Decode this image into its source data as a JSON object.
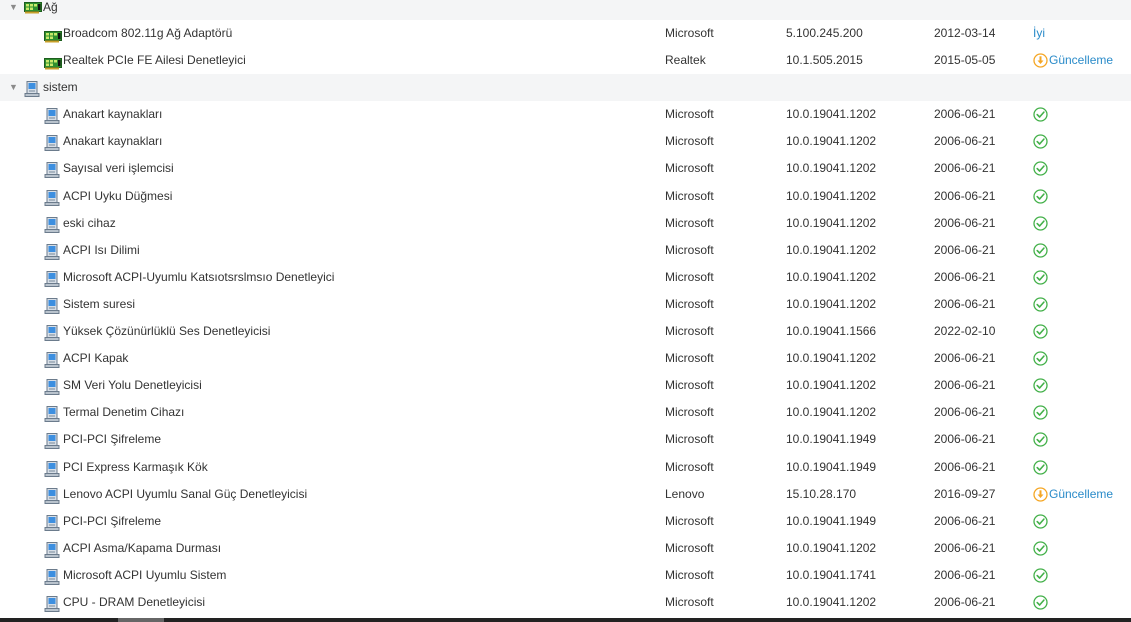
{
  "groups": [
    {
      "name": "Ağ",
      "icon": "network-card-icon",
      "devices": [
        {
          "name": "Broadcom 802.11g Ağ Adaptörü",
          "vendor": "Microsoft",
          "version": "5.100.245.200",
          "date": "2012-03-14",
          "status": "İyi",
          "status_type": "text"
        },
        {
          "name": "Realtek PCIe FE Ailesi Denetleyici",
          "vendor": "Realtek",
          "version": "10.1.505.2015",
          "date": "2015-05-05",
          "status": "Güncelleme",
          "status_type": "update"
        }
      ]
    },
    {
      "name": "sistem",
      "icon": "computer-icon",
      "devices": [
        {
          "name": "Anakart kaynakları",
          "vendor": "Microsoft",
          "version": "10.0.19041.1202",
          "date": "2006-06-21",
          "status_type": "ok"
        },
        {
          "name": "Anakart kaynakları",
          "vendor": "Microsoft",
          "version": "10.0.19041.1202",
          "date": "2006-06-21",
          "status_type": "ok"
        },
        {
          "name": "Sayısal veri işlemcisi",
          "vendor": "Microsoft",
          "version": "10.0.19041.1202",
          "date": "2006-06-21",
          "status_type": "ok"
        },
        {
          "name": "ACPI Uyku Düğmesi",
          "vendor": "Microsoft",
          "version": "10.0.19041.1202",
          "date": "2006-06-21",
          "status_type": "ok"
        },
        {
          "name": "eski cihaz",
          "vendor": "Microsoft",
          "version": "10.0.19041.1202",
          "date": "2006-06-21",
          "status_type": "ok"
        },
        {
          "name": "ACPI Isı Dilimi",
          "vendor": "Microsoft",
          "version": "10.0.19041.1202",
          "date": "2006-06-21",
          "status_type": "ok"
        },
        {
          "name": "Microsoft ACPI-Uyumlu Katsıotsrslmsıo Denetleyici",
          "vendor": "Microsoft",
          "version": "10.0.19041.1202",
          "date": "2006-06-21",
          "status_type": "ok"
        },
        {
          "name": "Sistem suresi",
          "vendor": "Microsoft",
          "version": "10.0.19041.1202",
          "date": "2006-06-21",
          "status_type": "ok"
        },
        {
          "name": "Yüksek Çözünürlüklü Ses Denetleyicisi",
          "vendor": "Microsoft",
          "version": "10.0.19041.1566",
          "date": "2022-02-10",
          "status_type": "ok"
        },
        {
          "name": "ACPI Kapak",
          "vendor": "Microsoft",
          "version": "10.0.19041.1202",
          "date": "2006-06-21",
          "status_type": "ok"
        },
        {
          "name": "SM Veri Yolu Denetleyicisi",
          "vendor": "Microsoft",
          "version": "10.0.19041.1202",
          "date": "2006-06-21",
          "status_type": "ok"
        },
        {
          "name": "Termal Denetim Cihazı",
          "vendor": "Microsoft",
          "version": "10.0.19041.1202",
          "date": "2006-06-21",
          "status_type": "ok"
        },
        {
          "name": "PCI-PCI Şifreleme",
          "vendor": "Microsoft",
          "version": "10.0.19041.1949",
          "date": "2006-06-21",
          "status_type": "ok"
        },
        {
          "name": "PCI Express Karmaşık Kök",
          "vendor": "Microsoft",
          "version": "10.0.19041.1949",
          "date": "2006-06-21",
          "status_type": "ok"
        },
        {
          "name": "Lenovo ACPI Uyumlu Sanal Güç Denetleyicisi",
          "vendor": "Lenovo",
          "version": "15.10.28.170",
          "date": "2016-09-27",
          "status": "Güncelleme",
          "status_type": "update"
        },
        {
          "name": "PCI-PCI Şifreleme",
          "vendor": "Microsoft",
          "version": "10.0.19041.1949",
          "date": "2006-06-21",
          "status_type": "ok"
        },
        {
          "name": "ACPI Asma/Kapama Durması",
          "vendor": "Microsoft",
          "version": "10.0.19041.1202",
          "date": "2006-06-21",
          "status_type": "ok"
        },
        {
          "name": "Microsoft ACPI Uyumlu Sistem",
          "vendor": "Microsoft",
          "version": "10.0.19041.1741",
          "date": "2006-06-21",
          "status_type": "ok"
        },
        {
          "name": "CPU - DRAM Denetleyicisi",
          "vendor": "Microsoft",
          "version": "10.0.19041.1202",
          "date": "2006-06-21",
          "status_type": "ok"
        }
      ]
    }
  ],
  "colors": {
    "ok": "#43b049",
    "update": "#f5a623",
    "link": "#2a8bc9",
    "group_bg": "#f4f5f6"
  }
}
